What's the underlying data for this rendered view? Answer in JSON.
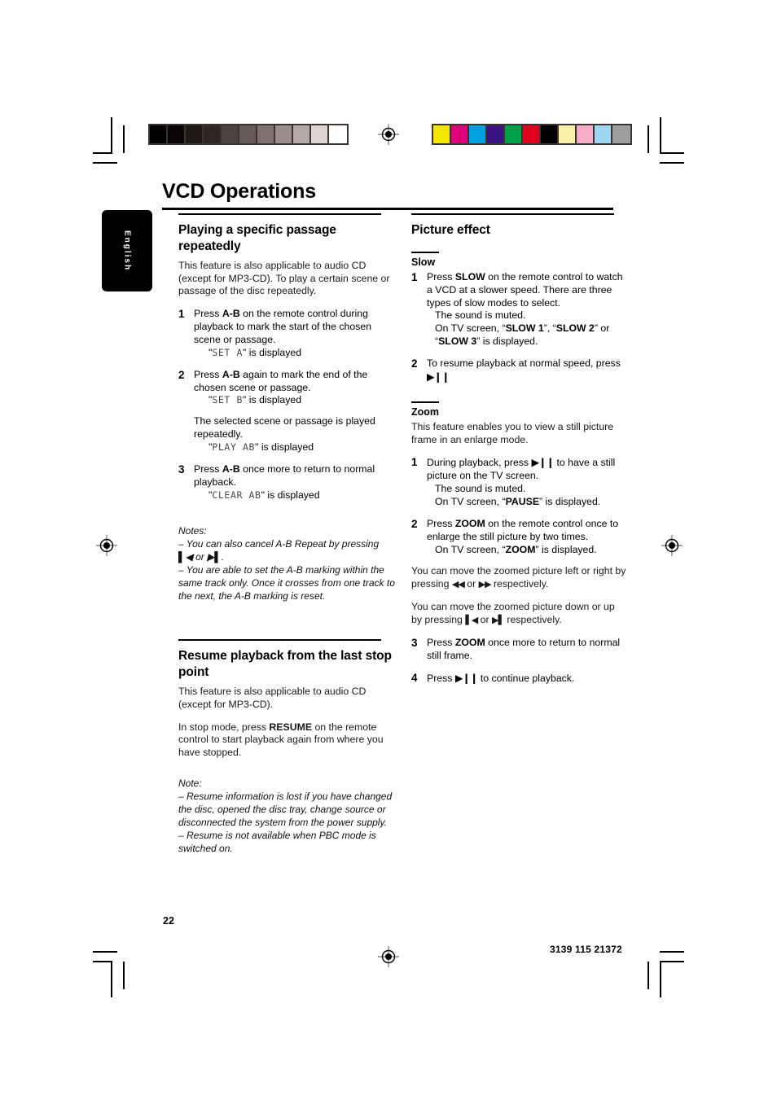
{
  "document": {
    "title": "VCD Operations",
    "language_tab": "English",
    "page_number": "22",
    "doc_code": "3139 115 21372"
  },
  "calibration": {
    "grayscale_bar": [
      "#000000",
      "#0a0607",
      "#1d1814",
      "#2e2722",
      "#4b423c",
      "#655b54",
      "#7e736c",
      "#9a8f88",
      "#b5aaa3",
      "#ddd6ce",
      "#ffffff"
    ],
    "color_bar": [
      "#f5e600",
      "#e0007a",
      "#00a0e0",
      "#3a1482",
      "#00a04b",
      "#e00020",
      "#000000",
      "#fbf0a8",
      "#f6aec8",
      "#9ed7f2",
      "#9e9e9e"
    ]
  },
  "left_column": {
    "section1": {
      "title": "Playing a specific passage repeatedly",
      "intro": "This feature is also applicable to audio CD (except for MP3-CD). To play a certain scene or passage of the disc repeatedly.",
      "steps": [
        {
          "num": "1",
          "pre": "Press ",
          "bold": "A-B",
          "post": " on the remote control during playback to mark the start of the chosen scene or passage.",
          "display_pre": "\"",
          "display": "SET A",
          "display_post": "\" is displayed"
        },
        {
          "num": "2",
          "pre": "Press ",
          "bold": "A-B",
          "post": " again to mark the end of the chosen scene or passage.",
          "display_pre": "\"",
          "display": "SET B",
          "display_post": "\" is displayed",
          "extra_text": "The selected scene or passage is played repeatedly.",
          "extra_display_pre": "\"",
          "extra_display": "PLAY AB",
          "extra_display_post": "\" is displayed"
        },
        {
          "num": "3",
          "pre": "Press ",
          "bold": "A-B",
          "post": " once more to return to normal playback.",
          "display_pre": "\"",
          "display": "CLEAR AB",
          "display_post": "\" is displayed"
        }
      ],
      "notes_heading": "Notes:",
      "notes": [
        "–  You can also cancel A-B Repeat by pressing ▌◀ or ▶▌.",
        "–  You are able to set the A-B marking within the same track only. Once it crosses from one track to the next, the A-B marking is reset."
      ]
    },
    "section2": {
      "title": "Resume playback from the last stop point",
      "intro": "This feature is also applicable to audio CD (except for MP3-CD).",
      "body_pre": "In stop mode, press ",
      "body_bold": "RESUME",
      "body_post": " on the remote control to start playback again from where you have stopped.",
      "notes_heading": "Note:",
      "notes": [
        "–  Resume information is lost if you have changed the disc, opened the disc tray, change source or disconnected the system from the power supply.",
        "–  Resume is not available when PBC mode is switched on."
      ]
    }
  },
  "right_column": {
    "section_title": "Picture effect",
    "slow": {
      "sub_title": "Slow",
      "steps": [
        {
          "num": "1",
          "pre": "Press ",
          "bold": "SLOW",
          "post": " on the remote control to watch a VCD at a slower speed. There are three types of slow modes to select.",
          "sub_lines": [
            "The sound is muted."
          ],
          "tv_pre": "On TV screen, “",
          "tv_b1": "SLOW 1",
          "tv_mid1": "”, “",
          "tv_b2": "SLOW 2",
          "tv_mid2": "” or “",
          "tv_b3": "SLOW 3",
          "tv_post": "” is displayed."
        },
        {
          "num": "2",
          "pre": "To resume playback at normal speed, press ",
          "glyph": "▶❙❙",
          "post": ""
        }
      ]
    },
    "zoom": {
      "sub_title": "Zoom",
      "intro": "This feature enables you to view a still picture frame in an enlarge mode.",
      "steps": [
        {
          "num": "1",
          "pre": "During playback, press ",
          "glyph": "▶❙❙",
          "post": " to have a still picture on the TV screen.",
          "sub_lines": [
            "The sound is muted."
          ],
          "tv_pre": "On TV screen, “",
          "tv_b1": "PAUSE",
          "tv_post": "” is displayed."
        },
        {
          "num": "2",
          "pre": "Press ",
          "bold": "ZOOM",
          "post": " on the remote control once to enlarge the still picture by two times.",
          "tv_pre": "On TV screen, “",
          "tv_b1": "ZOOM",
          "tv_post": "” is displayed."
        }
      ],
      "move_lr_pre": "You can move the zoomed picture left or right by pressing ",
      "move_lr_g1": "◀◀",
      "move_lr_mid": " or ",
      "move_lr_g2": "▶▶",
      "move_lr_post": " respectively.",
      "move_du_pre": "You can move the zoomed picture down or up by pressing ",
      "move_du_g1": "▌◀",
      "move_du_mid": " or ",
      "move_du_g2": "▶▌",
      "move_du_post": " respectively.",
      "steps_after": [
        {
          "num": "3",
          "pre": "Press ",
          "bold": "ZOOM",
          "post": " once more to return to normal still frame."
        },
        {
          "num": "4",
          "pre": "Press ",
          "glyph": "▶❙❙",
          "post": " to continue playback."
        }
      ]
    }
  }
}
